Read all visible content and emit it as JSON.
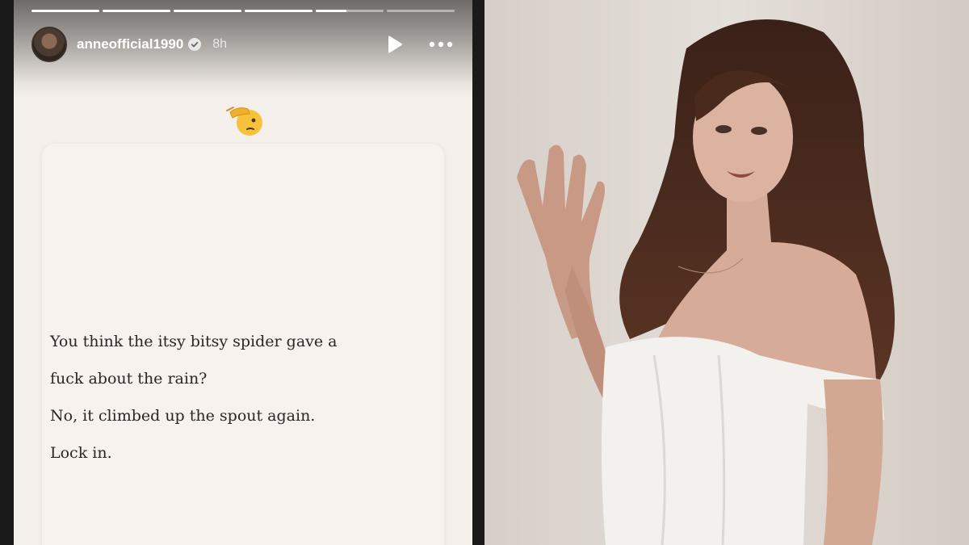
{
  "story": {
    "progress_segments": [
      1,
      1,
      1,
      1,
      0.45,
      0
    ],
    "header": {
      "username": "anneofficial1990",
      "verified": true,
      "timestamp": "8h"
    },
    "icons": {
      "avatar": "profile-avatar",
      "verified": "verified-check-icon",
      "play": "play-icon",
      "more": "more-dots-icon",
      "emoji": "saluting-face-emoji"
    },
    "quote_lines": [
      "You think the itsy bitsy spider gave a",
      "fuck about the rain?",
      "No, it climbed up the spout again.",
      "Lock in."
    ]
  },
  "photo": {
    "subject": "woman-in-white-off-shoulder-top-against-wall"
  },
  "colors": {
    "story_background": "#f4efea",
    "card": "#f7f2ee",
    "text": "#2b2623"
  }
}
